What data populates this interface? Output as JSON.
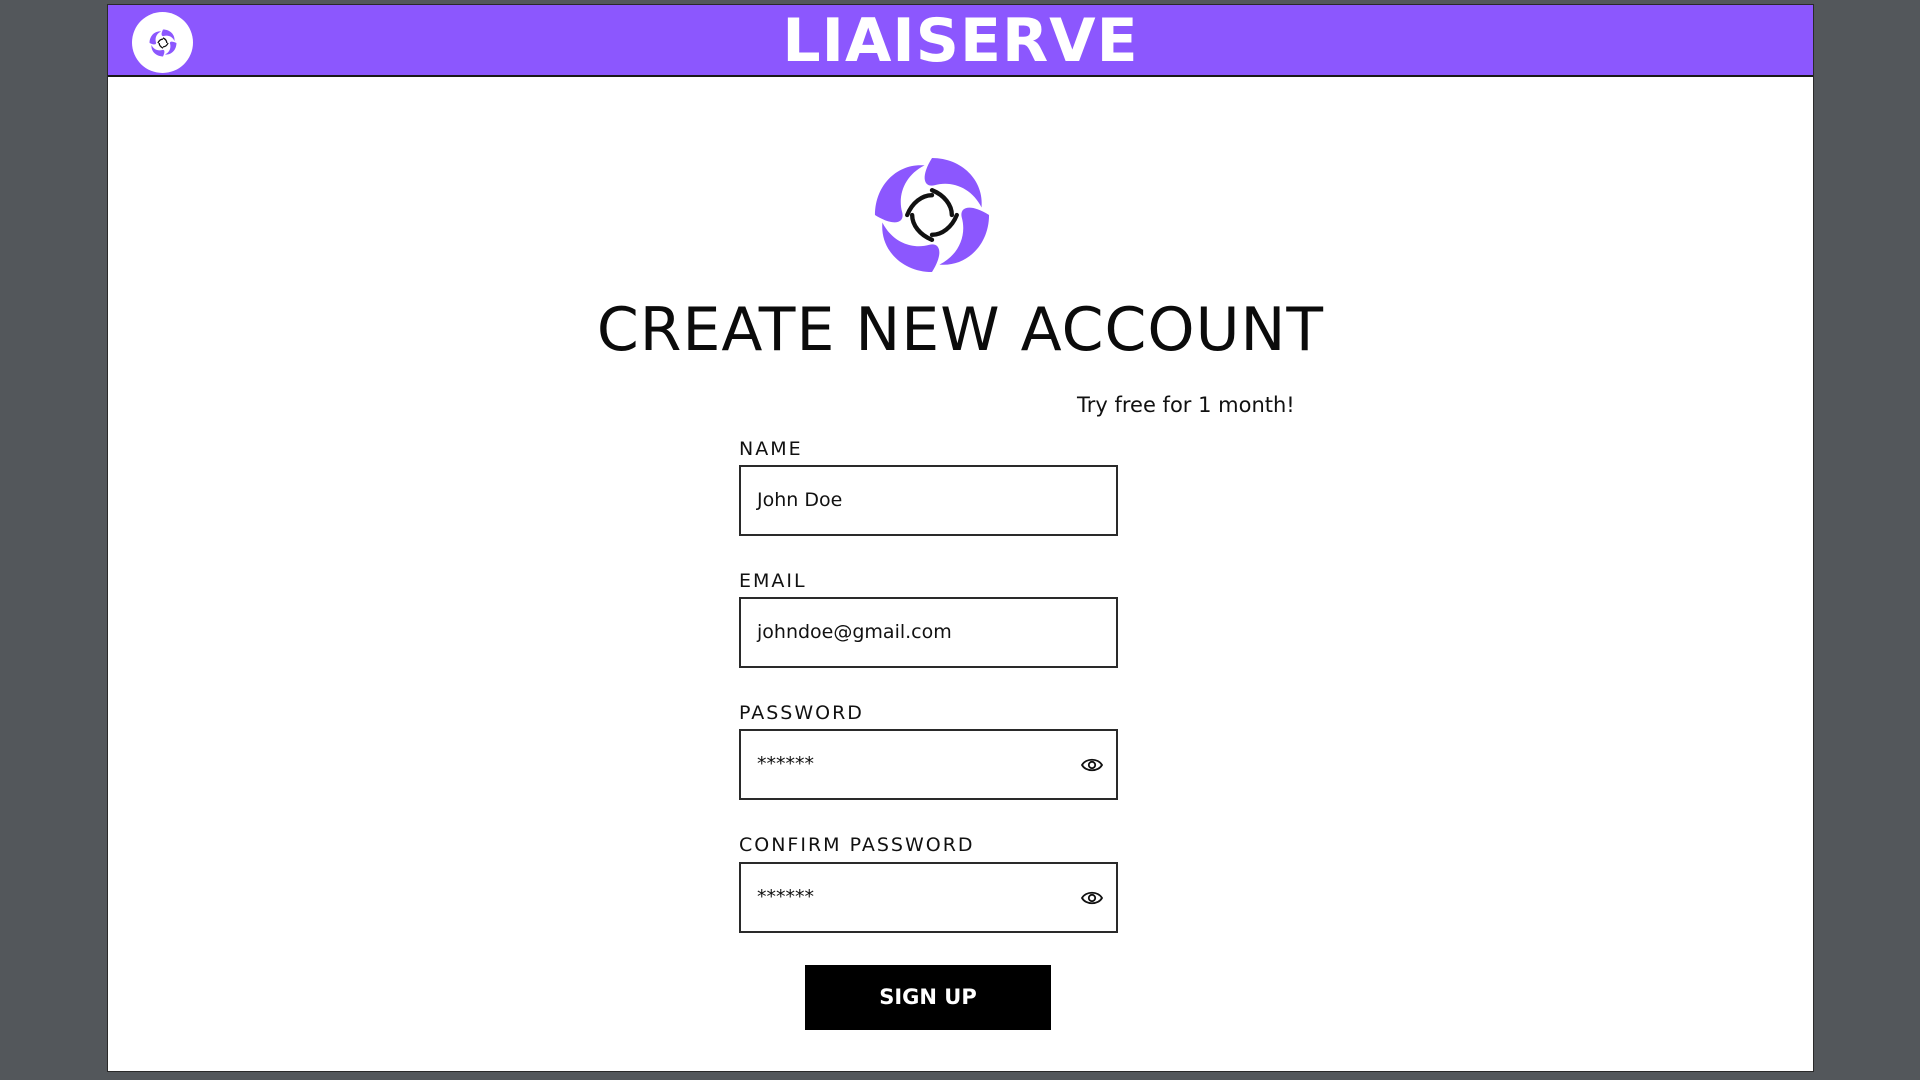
{
  "header": {
    "title": "LIAISERVE",
    "logo_icon": "swirl-logo-icon"
  },
  "main": {
    "logo_icon": "swirl-logo-icon",
    "title": "CREATE NEW ACCOUNT",
    "promo": "Try free for 1 month!"
  },
  "form": {
    "name": {
      "label": "NAME",
      "value": "John Doe"
    },
    "email": {
      "label": "EMAIL",
      "value": "johndoe@gmail.com"
    },
    "password": {
      "label": "PASSWORD",
      "value": "******",
      "icon": "eye-icon"
    },
    "confirm_password": {
      "label": "CONFIRM PASSWORD",
      "value": "******",
      "icon": "eye-icon"
    },
    "submit_label": "SIGN UP"
  },
  "colors": {
    "brand": "#8c57fe",
    "background": "#53575b",
    "button": "#000000"
  }
}
